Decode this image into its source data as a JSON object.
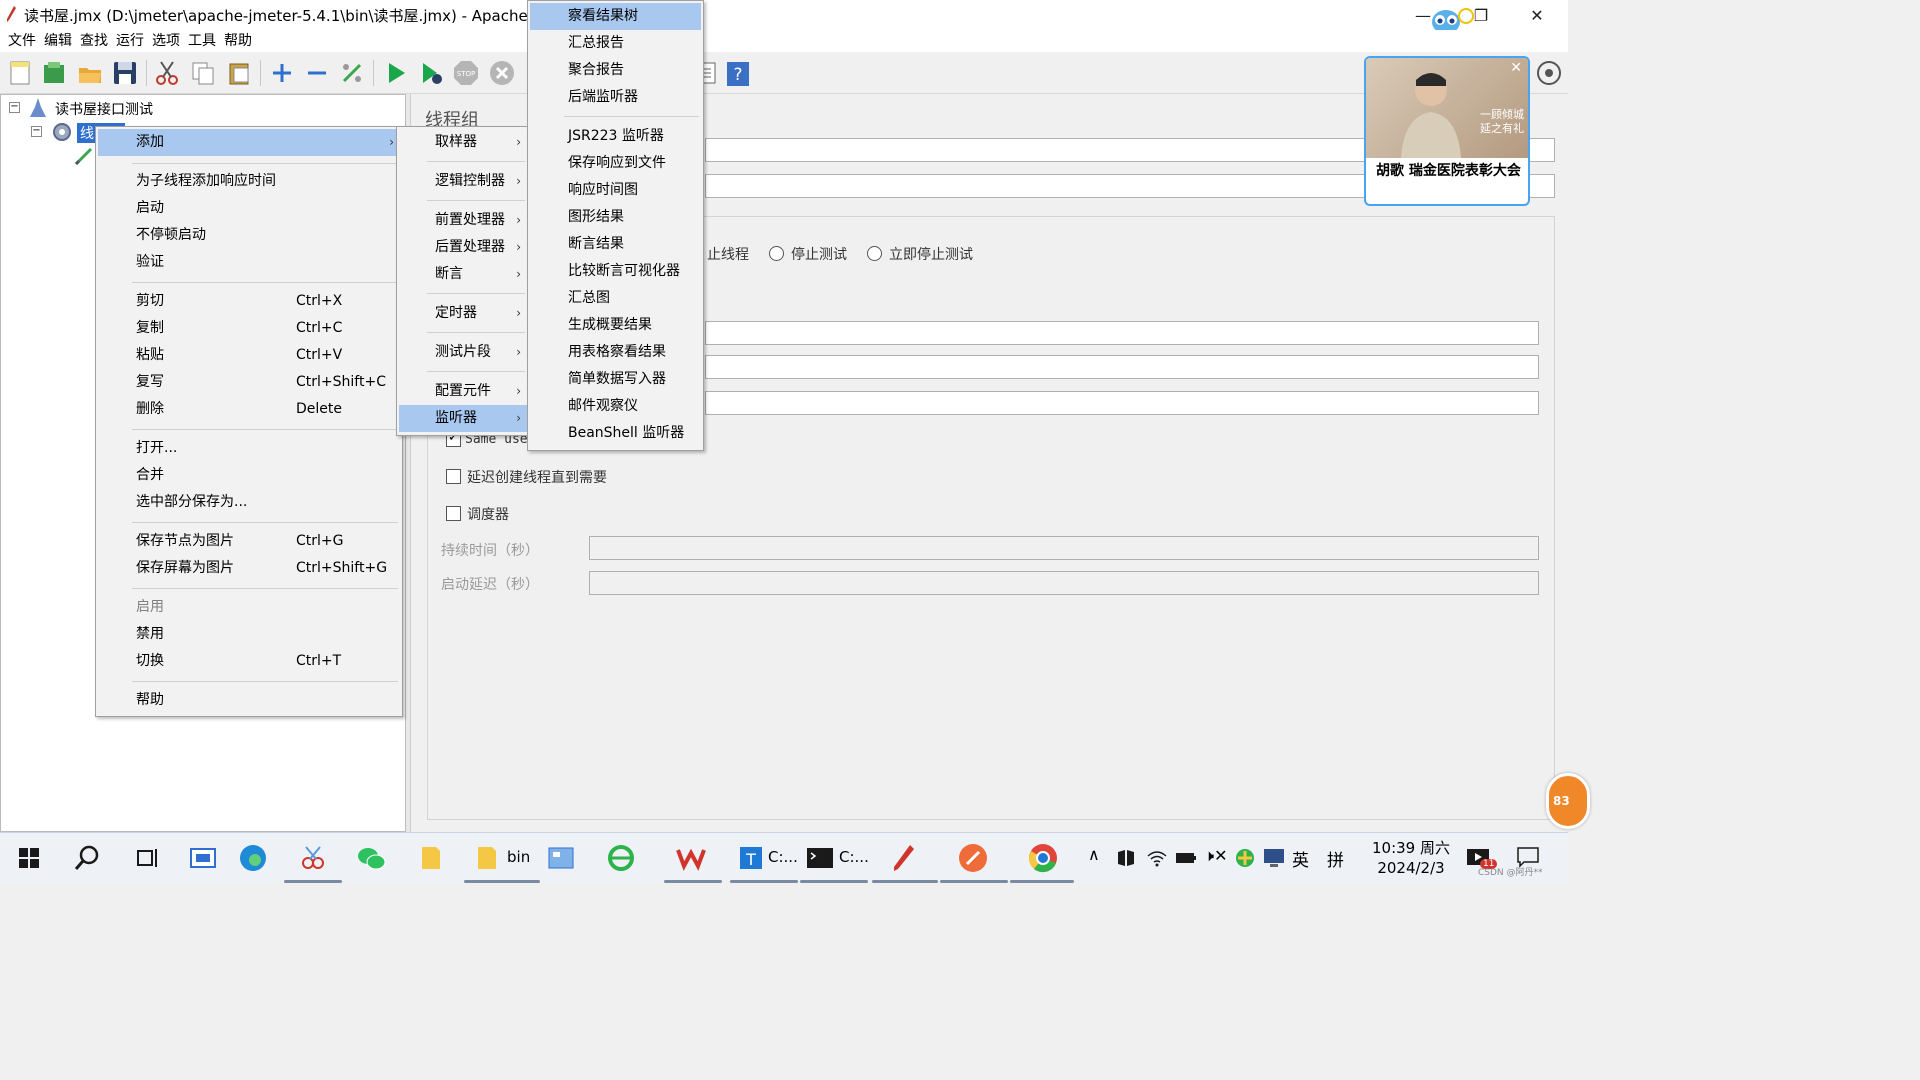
{
  "window": {
    "title": "读书屋.jmx (D:\\jmeter\\apache-jmeter-5.4.1\\bin\\读书屋.jmx) - Apache JM",
    "minimize_icon": "minimize-icon",
    "restore_icon": "restore-icon",
    "close_icon": "close-icon"
  },
  "menubar": [
    "文件",
    "编辑",
    "查找",
    "运行",
    "选项",
    "工具",
    "帮助"
  ],
  "tree": {
    "root_label": "读书屋接口测试",
    "thread_group_label": "线"
  },
  "right_panel": {
    "heading": "线程组",
    "radio_options": [
      "止线程",
      "停止测试",
      "立即停止测试"
    ],
    "same_user_label": "Same user",
    "delay_checkbox_label": "延迟创建线程直到需要",
    "scheduler_checkbox_label": "调度器",
    "duration_label": "持续时间（秒）",
    "startup_delay_label": "启动延迟（秒）"
  },
  "context_menu": {
    "items": [
      {
        "label": "添加",
        "shortcut": "",
        "submenu": true,
        "highlighted": true
      },
      {
        "label": "为子线程添加响应时间",
        "shortcut": ""
      },
      {
        "label": "启动",
        "shortcut": ""
      },
      {
        "label": "不停顿启动",
        "shortcut": ""
      },
      {
        "label": "验证",
        "shortcut": ""
      },
      {
        "label": "剪切",
        "shortcut": "Ctrl+X"
      },
      {
        "label": "复制",
        "shortcut": "Ctrl+C"
      },
      {
        "label": "粘贴",
        "shortcut": "Ctrl+V"
      },
      {
        "label": "复写",
        "shortcut": "Ctrl+Shift+C"
      },
      {
        "label": "删除",
        "shortcut": "Delete"
      },
      {
        "label": "打开...",
        "shortcut": ""
      },
      {
        "label": "合并",
        "shortcut": ""
      },
      {
        "label": "选中部分保存为...",
        "shortcut": ""
      },
      {
        "label": "保存节点为图片",
        "shortcut": "Ctrl+G"
      },
      {
        "label": "保存屏幕为图片",
        "shortcut": "Ctrl+Shift+G"
      },
      {
        "label": "启用",
        "shortcut": "",
        "disabled": true
      },
      {
        "label": "禁用",
        "shortcut": ""
      },
      {
        "label": "切换",
        "shortcut": "Ctrl+T"
      },
      {
        "label": "帮助",
        "shortcut": ""
      }
    ]
  },
  "add_submenu": {
    "items": [
      {
        "label": "取样器"
      },
      {
        "label": "逻辑控制器"
      },
      {
        "label": "前置处理器"
      },
      {
        "label": "后置处理器"
      },
      {
        "label": "断言"
      },
      {
        "label": "定时器"
      },
      {
        "label": "测试片段"
      },
      {
        "label": "配置元件"
      },
      {
        "label": "监听器",
        "highlighted": true
      }
    ]
  },
  "listener_submenu": {
    "items": [
      {
        "label": "察看结果树",
        "highlighted": true
      },
      {
        "label": "汇总报告"
      },
      {
        "label": "聚合报告"
      },
      {
        "label": "后端监听器"
      },
      {
        "label": "JSR223 监听器"
      },
      {
        "label": "保存响应到文件"
      },
      {
        "label": "响应时间图"
      },
      {
        "label": "图形结果"
      },
      {
        "label": "断言结果"
      },
      {
        "label": "比较断言可视化器"
      },
      {
        "label": "汇总图"
      },
      {
        "label": "生成概要结果"
      },
      {
        "label": "用表格察看结果"
      },
      {
        "label": "简单数据写入器"
      },
      {
        "label": "邮件观察仪"
      },
      {
        "label": "BeanShell 监听器"
      }
    ]
  },
  "popup": {
    "caption": "胡歌 瑞金医院表彰大会",
    "photo_text": "一顾倾城 延之有礼"
  },
  "taskbar": {
    "folder_label": "bin",
    "app1_label": "C:...",
    "app2_label": "C:...",
    "ime1": "英",
    "ime2": "拼",
    "time": "10:39 周六",
    "date": "2024/2/3",
    "badge": "83",
    "notif_badge": "11",
    "watermark": "CSDN @阿丹**"
  },
  "colors": {
    "highlight": "#a8c8f0",
    "menu_bg": "#f2f2f2",
    "run_green": "#1aa64a"
  }
}
